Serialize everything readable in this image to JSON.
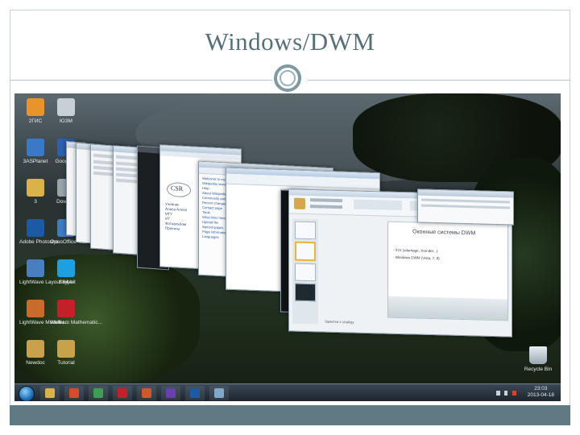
{
  "slide": {
    "title": "Windows/DWM"
  },
  "desktop": {
    "icons": [
      {
        "label": "2ГИС",
        "icon": "2gis-icon",
        "color": "#e8942a"
      },
      {
        "label": "ЮЗМ",
        "icon": "document-icon",
        "color": "#c8d0d6"
      },
      {
        "label": "3ASPlanet",
        "icon": "globe-icon",
        "color": "#3a78c8"
      },
      {
        "label": "Google E",
        "icon": "google-earth-icon",
        "color": "#2b5fb0"
      },
      {
        "label": "3",
        "icon": "folder-icon",
        "color": "#d9b24a"
      },
      {
        "label": "Dow Mo",
        "icon": "folder-icon",
        "color": "#9aa4ab"
      },
      {
        "label": "Adobe Photosho...",
        "icon": "photoshop-icon",
        "color": "#1c5aa6"
      },
      {
        "label": "OpenOffice 4.1.0",
        "icon": "openoffice-icon",
        "color": "#3d7bc4"
      },
      {
        "label": "LightWave Layout 64-bit",
        "icon": "lightwave-icon",
        "color": "#4a7fbf"
      },
      {
        "label": "Skype",
        "icon": "skype-icon",
        "color": "#1e9fe0"
      },
      {
        "label": "LightWave Modeler...",
        "icon": "lightwave-modeler-icon",
        "color": "#c96b2a"
      },
      {
        "label": "Wolfram Mathematic...",
        "icon": "mathematica-icon",
        "color": "#c4202a"
      },
      {
        "label": "Newdoc",
        "icon": "folder-icon",
        "color": "#c8a24a"
      },
      {
        "label": "Tutorial",
        "icon": "folder-icon",
        "color": "#c8a24a"
      },
      {
        "label": "Recycle Bin",
        "icon": "recycle-bin-icon",
        "color": "#b8c4cc"
      }
    ]
  },
  "windows": {
    "csr_logo": "CSR",
    "csr_menu": [
      "Учебник",
      "Алиса Аллеп",
      "МГУ",
      "ИТ",
      "Фотоальбом",
      "Проекты"
    ],
    "browser_links": [
      "Welcome to my page",
      "Wikipedia news",
      "Help",
      "About Wikipedia",
      "Community portal",
      "Recent changes",
      "Contact page",
      "Tools",
      "What links here",
      "Upload file",
      "Special pages",
      "Page information",
      "Languages"
    ],
    "ppt_slide_title": "Оконные системы DWM",
    "ppt_bullets": [
      "- X11 (xdamage, Xrender...)",
      "- Windows DWM (Vista, 7, 8)"
    ],
    "ppt_notes": "Заметки к слайду"
  },
  "taskbar": {
    "apps": [
      {
        "name": "explorer",
        "icon": "folder-icon",
        "color": "#d9b24a"
      },
      {
        "name": "chrome",
        "icon": "chrome-icon",
        "color": "#d84a2e"
      },
      {
        "name": "manager",
        "icon": "app-icon",
        "color": "#3e9e4f"
      },
      {
        "name": "mathematica",
        "icon": "mathematica-icon",
        "color": "#c4202a"
      },
      {
        "name": "powerpoint",
        "icon": "powerpoint-icon",
        "color": "#d0582a"
      },
      {
        "name": "visual-studio",
        "icon": "visual-studio-icon",
        "color": "#6a3fb0"
      },
      {
        "name": "photoshop",
        "icon": "photoshop-icon",
        "color": "#1c5aa6"
      },
      {
        "name": "desktop",
        "icon": "desktop-icon",
        "color": "#7fa8c9"
      }
    ],
    "time": "23:03",
    "date": "2013-04-18"
  }
}
